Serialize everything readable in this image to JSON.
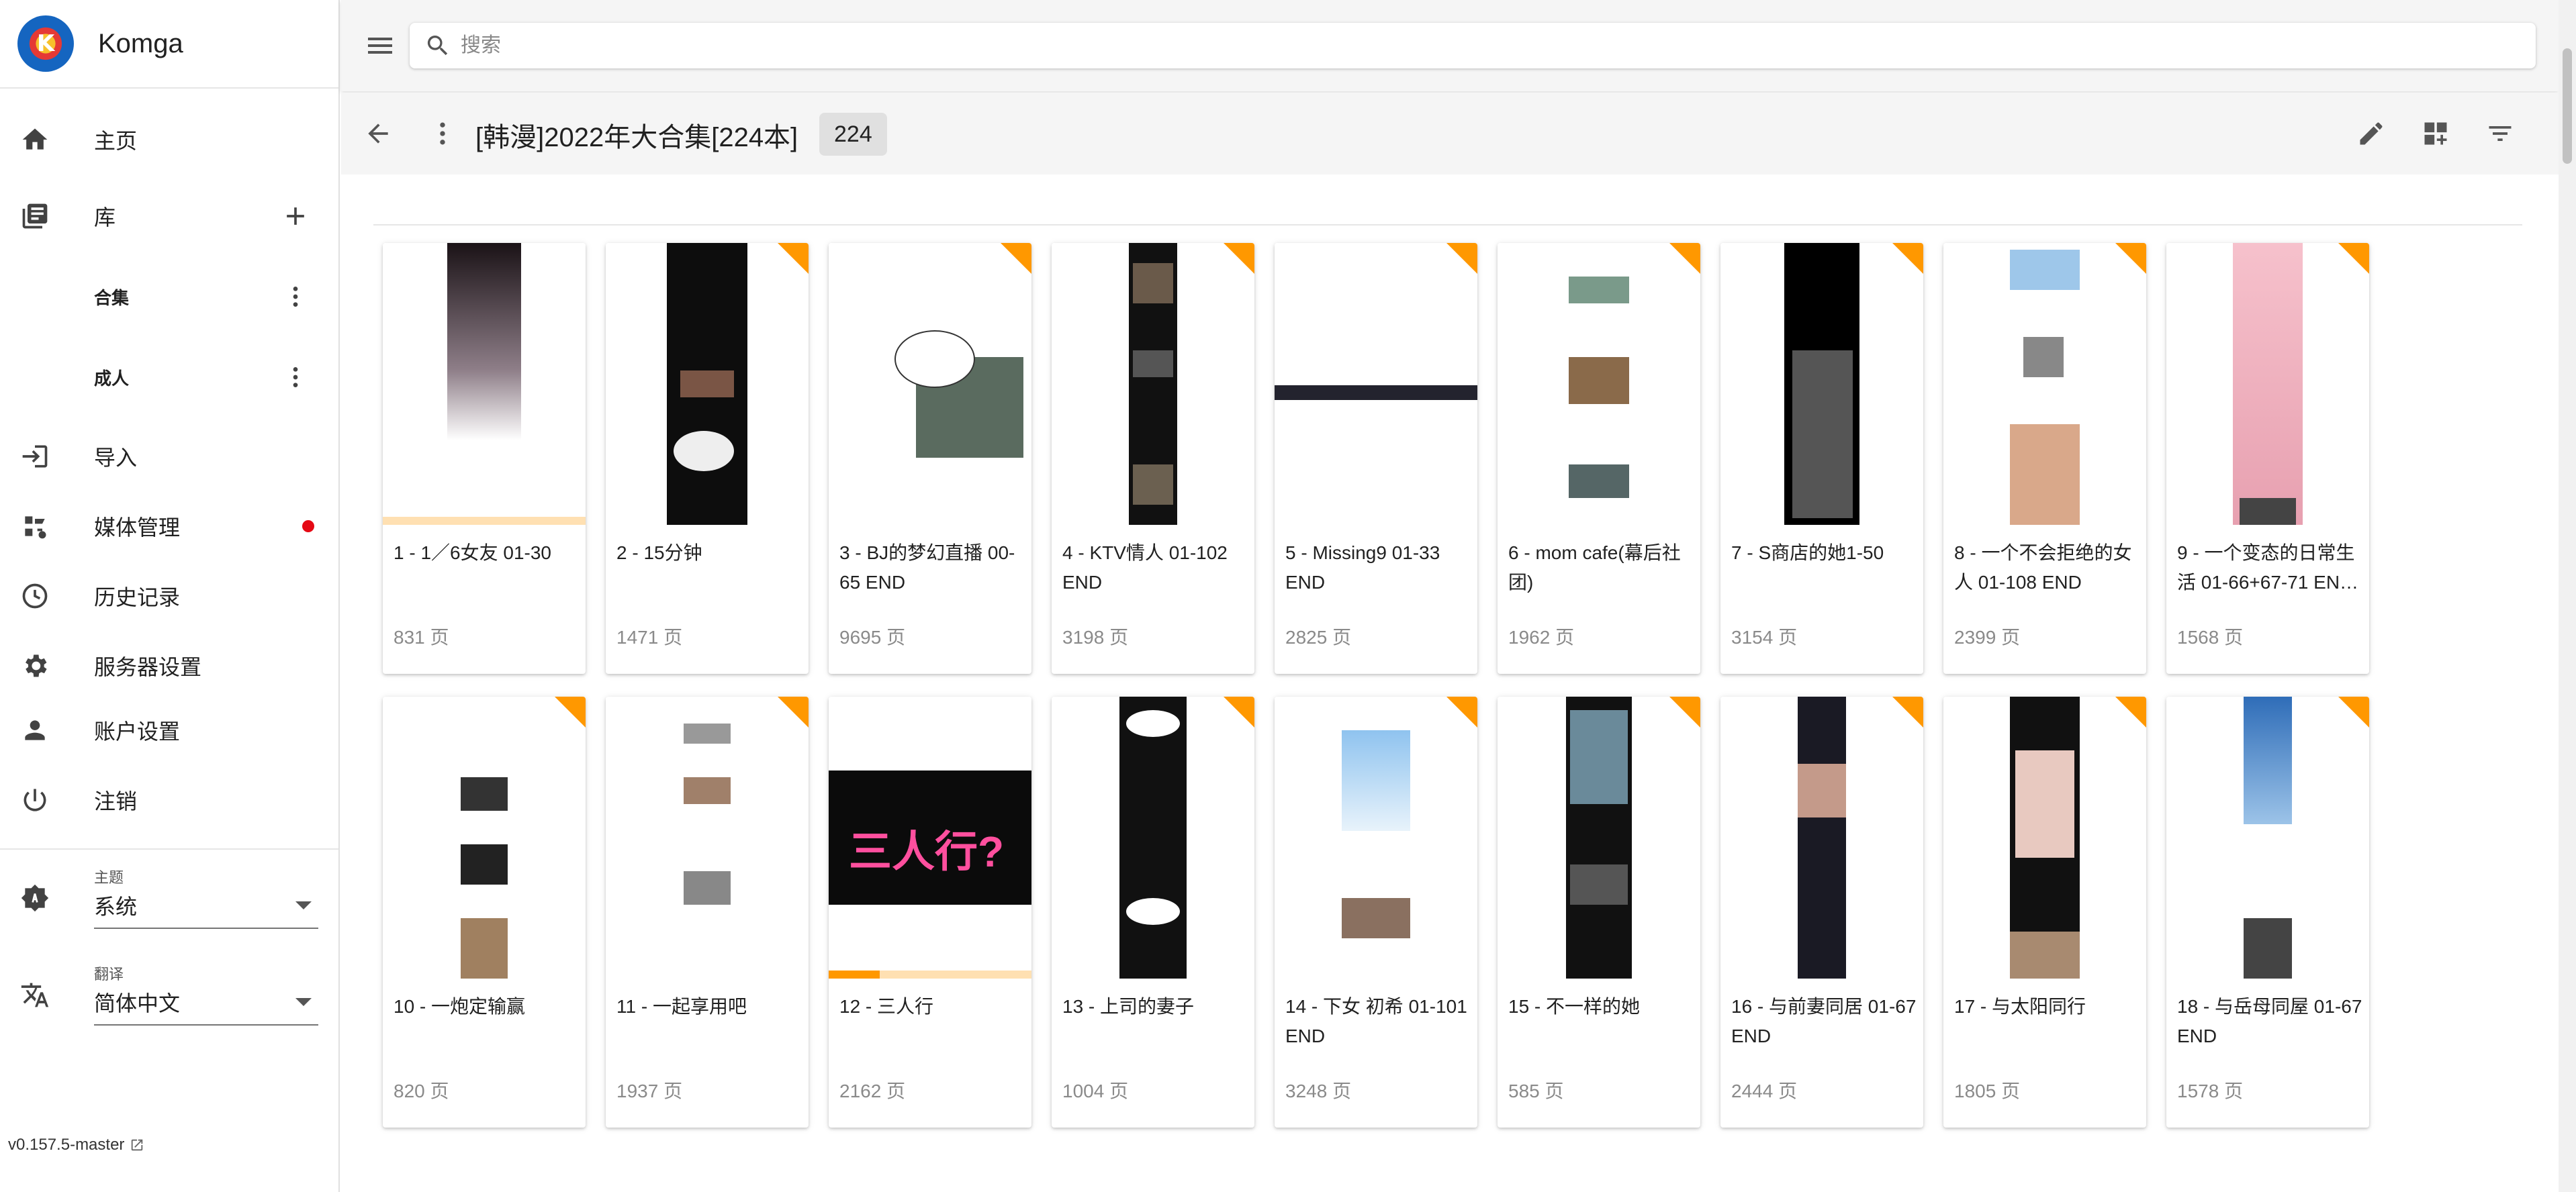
{
  "app": {
    "name": "Komga",
    "logo_letter": "K"
  },
  "sidebar": {
    "home": "主页",
    "libraries": "库",
    "sub_items": [
      {
        "label": "合集"
      },
      {
        "label": "成人"
      }
    ],
    "import": "导入",
    "media_management": "媒体管理",
    "history": "历史记录",
    "server_settings": "服务器设置",
    "account_settings": "账户设置",
    "logout": "注销",
    "theme_caption": "主题",
    "theme_value": "系统",
    "language_caption": "翻译",
    "language_value": "简体中文",
    "version": "v0.157.5-master"
  },
  "search": {
    "placeholder": "搜索"
  },
  "toolbar": {
    "title": "[韩漫]2022年大合集[224本]",
    "count": "224"
  },
  "colors": {
    "accent": "#ff9800",
    "unread_corner": "#ff9800",
    "badge_red": "#e50914"
  },
  "books": [
    {
      "title": "1 - 1／6女友 01-30",
      "pages": "831 页",
      "unread": false,
      "progress": 0,
      "cover": "gradient"
    },
    {
      "title": "2 - 15分钟",
      "pages": "1471 页",
      "unread": true,
      "progress": null,
      "cover": "dark"
    },
    {
      "title": "3 - BJ的梦幻直播 00-65 END",
      "pages": "9695 页",
      "unread": true,
      "progress": null,
      "cover": "bubble"
    },
    {
      "title": "4 - KTV情人 01-102 END",
      "pages": "3198 页",
      "unread": true,
      "progress": null,
      "cover": "dark-narrow"
    },
    {
      "title": "5 - Missing9 01-33 END",
      "pages": "2825 页",
      "unread": true,
      "progress": null,
      "cover": "bar"
    },
    {
      "title": "6 - mom cafe(幕后社团)",
      "pages": "1962 页",
      "unread": true,
      "progress": null,
      "cover": "panels"
    },
    {
      "title": "7 - S商店的她1-50",
      "pages": "3154 页",
      "unread": true,
      "progress": null,
      "cover": "building"
    },
    {
      "title": "8 - 一个不会拒绝的女人 01-108 END",
      "pages": "2399 页",
      "unread": true,
      "progress": null,
      "cover": "girl"
    },
    {
      "title": "9 - 一个变态的日常生活 01-66+67-71 EN…",
      "pages": "1568 页",
      "unread": true,
      "progress": null,
      "cover": "pink"
    },
    {
      "title": "10 - 一炮定输赢",
      "pages": "820 页",
      "unread": true,
      "progress": null,
      "cover": "sparse"
    },
    {
      "title": "11 - 一起享用吧",
      "pages": "1937 页",
      "unread": true,
      "progress": null,
      "cover": "strips"
    },
    {
      "title": "12 - 三人行",
      "pages": "2162 页",
      "unread": false,
      "progress": 0.25,
      "cover": "neon"
    },
    {
      "title": "13 - 上司的妻子",
      "pages": "1004 页",
      "unread": true,
      "progress": null,
      "cover": "dark-bubbles"
    },
    {
      "title": "14 - 下女 初希 01-101 END",
      "pages": "3248 页",
      "unread": true,
      "progress": null,
      "cover": "sky"
    },
    {
      "title": "15 - 不一样的她",
      "pages": "585 页",
      "unread": true,
      "progress": null,
      "cover": "city"
    },
    {
      "title": "16 - 与前妻同居 01-67 END",
      "pages": "2444 页",
      "unread": true,
      "progress": null,
      "cover": "dark-girl"
    },
    {
      "title": "17 - 与太阳同行",
      "pages": "1805 页",
      "unread": true,
      "progress": null,
      "cover": "skin"
    },
    {
      "title": "18 - 与岳母同屋 01-67 END",
      "pages": "1578 页",
      "unread": true,
      "progress": null,
      "cover": "plane"
    }
  ]
}
